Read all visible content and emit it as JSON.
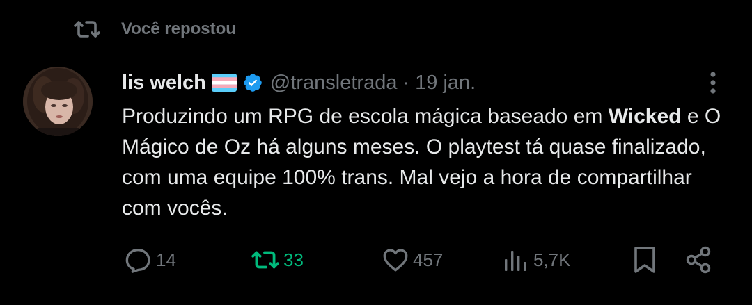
{
  "repost_banner": {
    "label": "Você repostou",
    "icon": "repost-icon"
  },
  "tweet": {
    "author": {
      "display_name": "lis welch",
      "flag": "transgender-flag",
      "verified": true,
      "handle": "@transletrada"
    },
    "separator": "·",
    "date": "19 jan.",
    "text": {
      "part1": "Produzindo um RPG de escola mágica baseado em ",
      "bold": "Wicked",
      "part2": " e O Mágico de Oz há alguns meses. O playtest tá quase finalizado, com uma equipe 100% trans. Mal vejo a hora de compartilhar com vocês."
    }
  },
  "actions": {
    "replies": "14",
    "reposts": "33",
    "likes": "457",
    "views": "5,7K"
  },
  "colors": {
    "background": "#000000",
    "text": "#e7e9ea",
    "muted": "#71767b",
    "repost_green": "#00ba7c",
    "verified_blue": "#1d9bf0"
  }
}
